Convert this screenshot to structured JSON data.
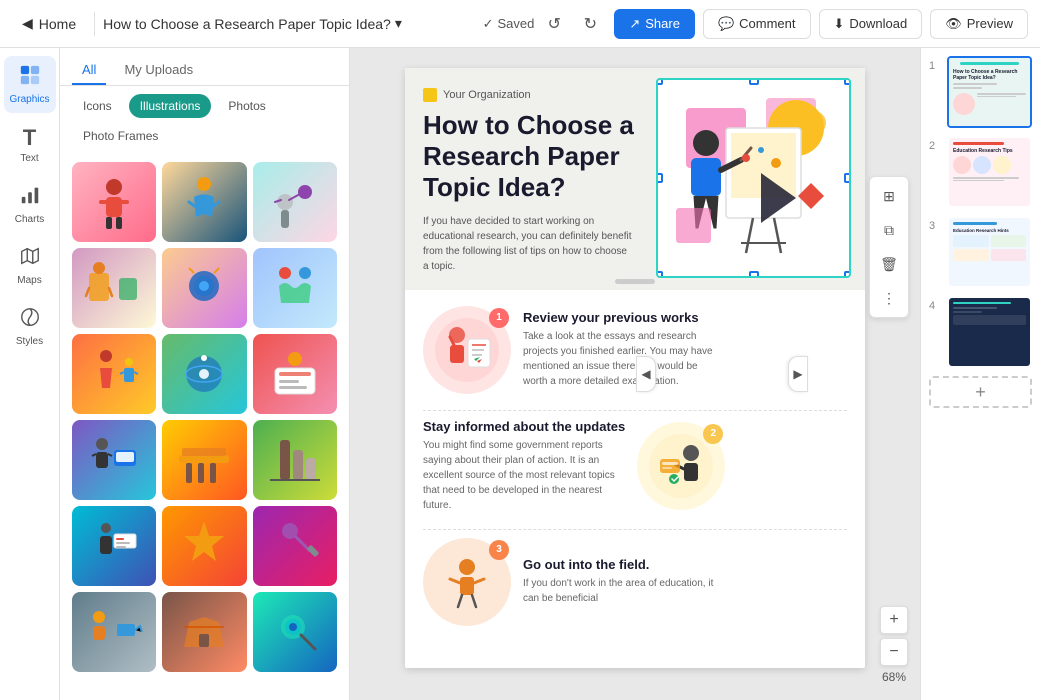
{
  "topbar": {
    "home_label": "Home",
    "title": "How to Choose a  Research Paper Topic Idea?",
    "saved_label": "Saved",
    "share_label": "Share",
    "comment_label": "Comment",
    "download_label": "Download",
    "preview_label": "Preview"
  },
  "left_sidebar": {
    "items": [
      {
        "id": "graphics",
        "label": "Graphics",
        "icon": "⬡",
        "active": true
      },
      {
        "id": "text",
        "label": "Text",
        "icon": "T",
        "active": false
      },
      {
        "id": "charts",
        "label": "Charts",
        "icon": "📊",
        "active": false
      },
      {
        "id": "maps",
        "label": "Maps",
        "icon": "🗺",
        "active": false
      },
      {
        "id": "styles",
        "label": "Styles",
        "icon": "✦",
        "active": false
      }
    ]
  },
  "panel": {
    "tab_all": "All",
    "tab_uploads": "My Uploads",
    "filters": [
      {
        "label": "Icons",
        "active": false
      },
      {
        "label": "Illustrations",
        "active": true
      },
      {
        "label": "Photos",
        "active": false
      },
      {
        "label": "Photo Frames",
        "active": false
      }
    ],
    "illustrations": [
      {
        "id": 1,
        "class": "illus-1",
        "emoji": "🧑‍🎨"
      },
      {
        "id": 2,
        "class": "illus-2",
        "emoji": "🤸"
      },
      {
        "id": 3,
        "class": "illus-3",
        "emoji": "🚴"
      },
      {
        "id": 4,
        "class": "illus-4",
        "emoji": "🧘"
      },
      {
        "id": 5,
        "class": "illus-5",
        "emoji": "🏋️"
      },
      {
        "id": 6,
        "class": "illus-6",
        "emoji": "🤝"
      },
      {
        "id": 7,
        "class": "illus-7",
        "emoji": "🧗"
      },
      {
        "id": 8,
        "class": "illus-8",
        "emoji": "🌍"
      },
      {
        "id": 9,
        "class": "illus-9",
        "emoji": "🎨"
      },
      {
        "id": 10,
        "class": "illus-10",
        "emoji": "🖥️"
      },
      {
        "id": 11,
        "class": "illus-11",
        "emoji": "🏗️"
      },
      {
        "id": 12,
        "class": "illus-12",
        "emoji": "🪵"
      },
      {
        "id": 13,
        "class": "illus-13",
        "emoji": "📚"
      },
      {
        "id": 14,
        "class": "illus-14",
        "emoji": "🎯"
      },
      {
        "id": 15,
        "class": "illus-15",
        "emoji": "🔭"
      },
      {
        "id": 16,
        "class": "illus-16",
        "emoji": "💼"
      },
      {
        "id": 17,
        "class": "illus-17",
        "emoji": "🏠"
      },
      {
        "id": 18,
        "class": "illus-18",
        "emoji": "🔬"
      }
    ]
  },
  "canvas": {
    "org_label": "Your Organization",
    "title": "How to Choose a Research Paper Topic Idea?",
    "description": "If you have decided to start working on educational research, you can definitely benefit from the following list of tips on how to choose a topic.",
    "steps": [
      {
        "num": "1",
        "color": "#ff6b6b",
        "bg": "#ffd6d6",
        "title": "Review your previous works",
        "text": "Take a look at the essays and research projects you finished earlier. You may have mentioned an issue there that would be worth a more detailed examination."
      },
      {
        "num": "2",
        "color": "#f9c74f",
        "bg": "#fff3cd",
        "title": "Stay informed about the updates",
        "text": "You might find some government reports saying about their plan of action. It is an excellent source of the most relevant topics that need to be developed in the nearest future."
      },
      {
        "num": "3",
        "color": "#f9844a",
        "bg": "#fde8d8",
        "title": "Go out into the field.",
        "text": "If you don't work in the area of education, it can be beneficial"
      }
    ],
    "zoom_level": "68%"
  },
  "pages": [
    {
      "num": "1",
      "active": true,
      "style": "teal"
    },
    {
      "num": "2",
      "active": false,
      "style": "pink"
    },
    {
      "num": "3",
      "active": false,
      "style": "light"
    },
    {
      "num": "4",
      "active": false,
      "style": "dark"
    }
  ],
  "toolbar_tools": [
    {
      "icon": "⊞",
      "name": "grid-tool"
    },
    {
      "icon": "⧉",
      "name": "copy-tool"
    },
    {
      "icon": "🗑",
      "name": "delete-tool"
    },
    {
      "icon": "⧗",
      "name": "more-tool"
    }
  ]
}
